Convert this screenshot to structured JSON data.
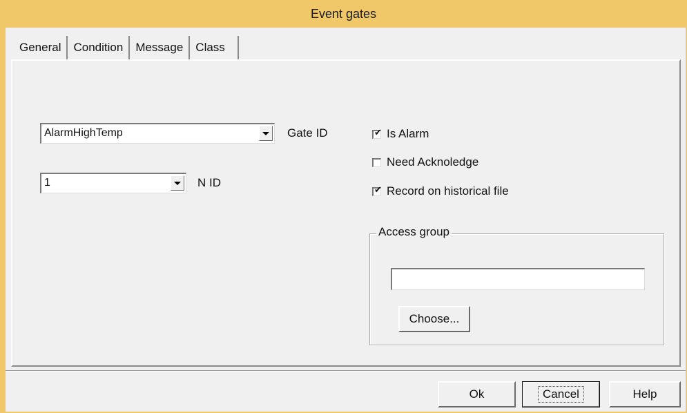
{
  "window": {
    "title": "Event gates"
  },
  "tabs": [
    {
      "label": "General",
      "active": true
    },
    {
      "label": "Condition",
      "active": false
    },
    {
      "label": "Message",
      "active": false
    },
    {
      "label": "Class",
      "active": false
    }
  ],
  "general": {
    "gate_id": {
      "value": "AlarmHighTemp",
      "label": "Gate ID"
    },
    "n_id": {
      "value": "1",
      "label": "N ID"
    },
    "checkboxes": [
      {
        "label": "Is Alarm",
        "checked": true
      },
      {
        "label": "Need Acknoledge",
        "checked": false
      },
      {
        "label": "Record on historical file",
        "checked": true
      }
    ],
    "access_group": {
      "legend": "Access group",
      "value": "",
      "choose_label": "Choose..."
    }
  },
  "footer": {
    "ok_label": "Ok",
    "cancel_label": "Cancel",
    "help_label": "Help"
  },
  "colors": {
    "titlebar": "#f0c86a",
    "dialog_bg": "#f0f0f0"
  }
}
